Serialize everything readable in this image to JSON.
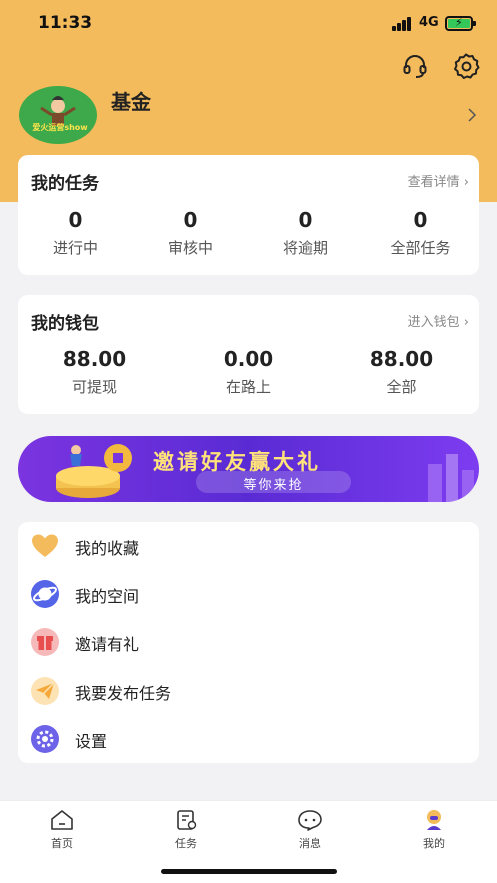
{
  "status": {
    "time": "11:33",
    "network": "4G"
  },
  "profile": {
    "name": "基金",
    "avatar_text": "爱火运营show"
  },
  "tasks": {
    "title": "我的任务",
    "link": "查看详情 ›",
    "stats": [
      {
        "value": "0",
        "label": "进行中"
      },
      {
        "value": "0",
        "label": "审核中"
      },
      {
        "value": "0",
        "label": "将逾期"
      },
      {
        "value": "0",
        "label": "全部任务"
      }
    ]
  },
  "wallet": {
    "title": "我的钱包",
    "link": "进入钱包 ›",
    "stats": [
      {
        "value": "88.00",
        "label": "可提现"
      },
      {
        "value": "0.00",
        "label": "在路上"
      },
      {
        "value": "88.00",
        "label": "全部"
      }
    ]
  },
  "banner": {
    "main": "邀请好友赢大礼",
    "sub": "等你来抢"
  },
  "menu": [
    {
      "label": "我的收藏",
      "icon": "heart-icon"
    },
    {
      "label": "我的空间",
      "icon": "planet-icon"
    },
    {
      "label": "邀请有礼",
      "icon": "gift-icon"
    },
    {
      "label": "我要发布任务",
      "icon": "paper-plane-icon"
    },
    {
      "label": "设置",
      "icon": "gear-icon"
    }
  ],
  "tabbar": [
    {
      "label": "首页",
      "icon": "home-icon"
    },
    {
      "label": "任务",
      "icon": "task-icon"
    },
    {
      "label": "消息",
      "icon": "message-icon"
    },
    {
      "label": "我的",
      "icon": "profile-icon"
    }
  ],
  "colors": {
    "header": "#f4bb5c",
    "accent": "#f4bb5c",
    "banner": "#6a2fdc"
  }
}
